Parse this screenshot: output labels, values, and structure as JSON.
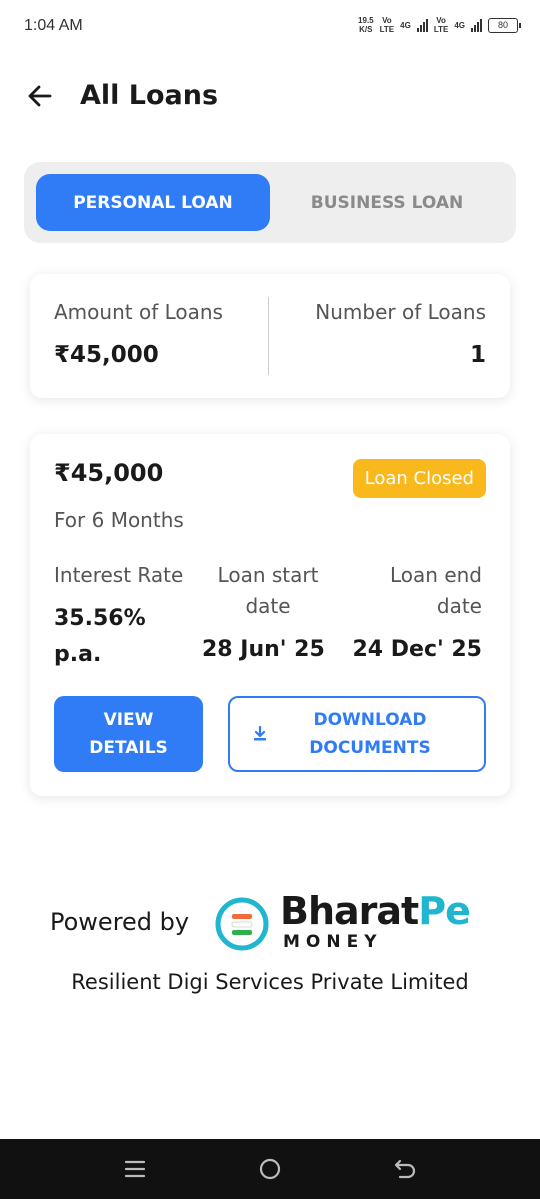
{
  "status_bar": {
    "time": "1:04 AM",
    "net_speed": "19.5",
    "net_speed_unit": "K/S",
    "sim1_label": "Vo",
    "sim1_sub": "LTE",
    "sim1_type": "4G",
    "sim2_label": "Vo",
    "sim2_sub": "LTE",
    "sim2_type": "4G",
    "battery": "80"
  },
  "header": {
    "back_icon": "arrow-left-icon",
    "title": "All Loans"
  },
  "tabs": {
    "active": "PERSONAL LOAN",
    "inactive": "BUSINESS LOAN",
    "active_color": "#2f7cf6"
  },
  "summary": {
    "amount_label": "Amount of Loans",
    "amount_value": "₹45,000",
    "count_label": "Number of Loans",
    "count_value": "1"
  },
  "loan": {
    "amount": "₹45,000",
    "duration": "For 6 Months",
    "status": "Loan Closed",
    "status_color": "#f9b81b",
    "interest_label": "Interest Rate",
    "interest_value_line1": "35.56%",
    "interest_value_line2": "p.a.",
    "start_label_line1": "Loan start",
    "start_label_line2": "date",
    "start_value": "28 Jun' 25",
    "end_label_line1": "Loan end",
    "end_label_line2": "date",
    "end_value": "24 Dec' 25",
    "view_details_line1": "VIEW",
    "view_details_line2": "DETAILS",
    "download_line1": "DOWNLOAD",
    "download_line2": "DOCUMENTS",
    "download_icon": "download-icon"
  },
  "footer": {
    "powered_by": "Powered by",
    "brand_part1": "Bharat",
    "brand_part2": "Pe",
    "brand_sub": "MONEY",
    "brand_accent": "#20b6cf",
    "company": "Resilient Digi Services Private Limited"
  },
  "nav": {
    "menu_icon": "menu-icon",
    "home_icon": "home-circle-icon",
    "back_icon": "back-icon"
  }
}
